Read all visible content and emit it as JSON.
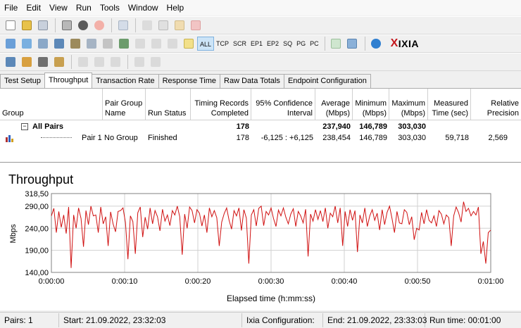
{
  "menu": [
    "File",
    "Edit",
    "View",
    "Run",
    "Tools",
    "Window",
    "Help"
  ],
  "toolbar": {
    "filters": [
      "ALL",
      "TCP",
      "SCR",
      "EP1",
      "EP2",
      "SQ",
      "PG",
      "PC"
    ],
    "active_filter": "ALL",
    "logo_x": "X",
    "logo_text": "IXIA"
  },
  "tabs": [
    "Test Setup",
    "Throughput",
    "Transaction Rate",
    "Response Time",
    "Raw Data Totals",
    "Endpoint Configuration"
  ],
  "active_tab": "Throughput",
  "grid": {
    "headers": {
      "group": "Group",
      "pair_group_name": "Pair Group Name",
      "run_status": "Run Status",
      "timing_records": "Timing Records Completed",
      "confidence": "95% Confidence Interval",
      "average": "Average (Mbps)",
      "minimum": "Minimum (Mbps)",
      "maximum": "Maximum (Mbps)",
      "measured_time": "Measured Time (sec)",
      "relative_precision": "Relative Precision"
    },
    "all_pairs": {
      "toggle": "−",
      "label": "All Pairs",
      "timing_records": "178",
      "average": "237,940",
      "minimum": "146,789",
      "maximum": "303,030"
    },
    "pair1": {
      "label": "Pair 1",
      "group_name": "No Group",
      "run_status": "Finished",
      "timing_records": "178",
      "confidence": "-6,125 : +6,125",
      "average": "238,454",
      "minimum": "146,789",
      "maximum": "303,030",
      "measured_time": "59,718",
      "relative_precision": "2,569"
    }
  },
  "chart_data": {
    "type": "line",
    "title": "Throughput",
    "xlabel": "Elapsed time (h:mm:ss)",
    "ylabel": "Mbps",
    "ylim": [
      140.0,
      318.5
    ],
    "yticks": [
      "318,50",
      "290,00",
      "240,00",
      "190,00",
      "140,00"
    ],
    "ytick_values": [
      318.5,
      290.0,
      240.0,
      190.0,
      140.0
    ],
    "xticks": [
      "0:00:00",
      "0:00:10",
      "0:00:20",
      "0:00:30",
      "0:00:40",
      "0:00:50",
      "0:01:00"
    ],
    "xlim_seconds": [
      0,
      60
    ],
    "grid": true,
    "color": "#d01010",
    "series": [
      {
        "values": [
          268,
          285,
          230,
          278,
          242,
          270,
          228,
          288,
          150,
          270,
          240,
          286,
          262,
          198,
          280,
          248,
          290,
          268,
          270,
          230,
          288,
          250,
          266,
          200,
          277,
          250,
          232,
          278,
          280,
          286,
          253,
          170,
          268,
          255,
          182,
          275,
          288,
          220,
          265,
          238,
          286,
          250,
          280,
          266,
          234,
          283,
          256,
          270,
          246,
          280,
          270,
          290,
          266,
          180,
          272,
          240,
          288,
          280,
          252,
          282,
          274,
          245,
          270,
          230,
          286,
          266,
          280,
          264,
          200,
          254,
          273,
          286,
          258,
          238,
          280,
          268,
          286,
          235,
          282,
          263,
          160,
          270,
          282,
          245,
          285,
          290,
          246,
          278,
          270,
          286,
          262,
          244,
          281,
          268,
          286,
          265,
          250,
          272,
          284,
          244,
          278,
          268,
          252,
          283,
          176,
          272,
          256,
          282,
          260,
          280,
          255,
          286,
          240,
          274,
          266,
          290,
          252,
          286,
          200,
          278,
          244,
          282,
          258,
          280,
          186,
          270,
          252,
          286,
          244,
          268,
          282,
          258,
          274,
          236,
          282,
          248,
          276,
          290,
          262,
          230,
          278,
          252,
          250,
          282,
          276,
          248,
          266,
          214,
          240,
          236,
          276,
          250,
          282,
          258,
          252,
          268,
          244,
          280,
          272,
          250,
          270,
          264,
          200,
          268,
          288,
          275,
          254,
          300,
          278,
          285,
          268,
          278,
          270,
          288,
          182,
          210,
          160,
          230,
          236
        ]
      }
    ]
  },
  "status": {
    "pairs": "Pairs: 1",
    "start": "Start: 21.09.2022, 23:32:03",
    "ixia": "Ixia Configuration:",
    "end": "End: 21.09.2022, 23:33:03",
    "runtime": "Run time: 00:01:00"
  }
}
